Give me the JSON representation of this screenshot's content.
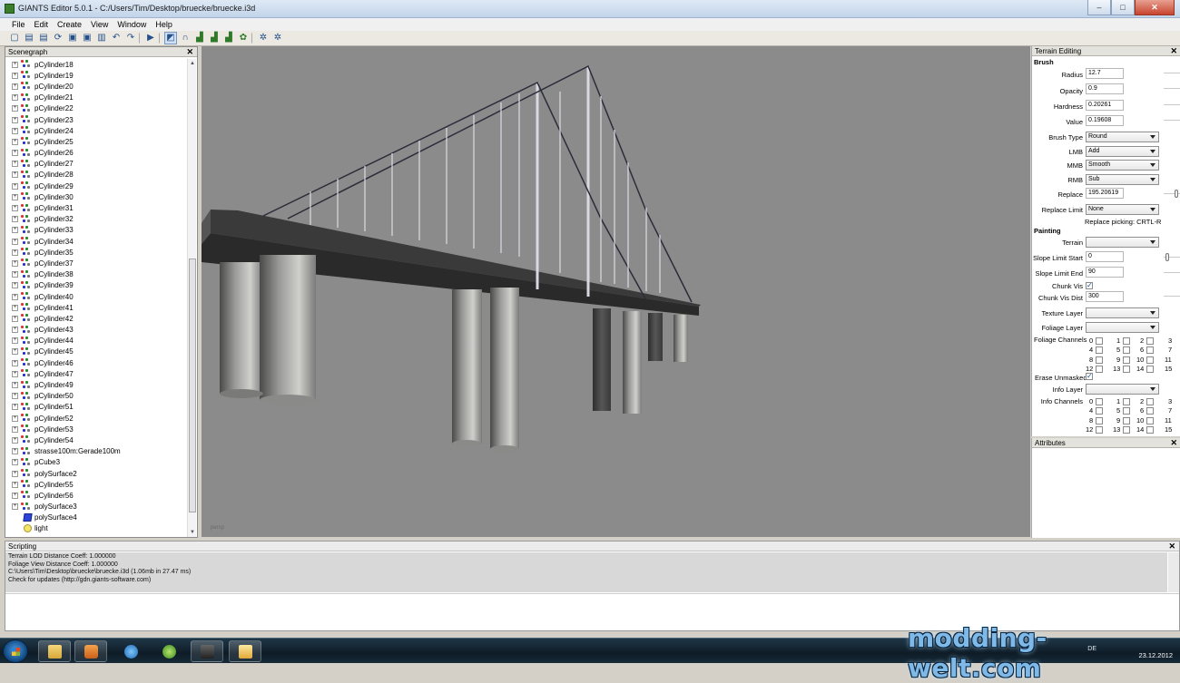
{
  "window": {
    "title": "GIANTS Editor 5.0.1 - C:/Users/Tim/Desktop/bruecke/bruecke.i3d",
    "controls": {
      "minimize": "–",
      "maximize": "□",
      "close": "✕"
    }
  },
  "menu": [
    "File",
    "Edit",
    "Create",
    "View",
    "Window",
    "Help"
  ],
  "toolbar": {
    "icons": [
      "new-file-icon",
      "open-folder-icon",
      "open-folder-icon",
      "refresh-icon",
      "save-icon",
      "save-as-icon",
      "clipboard-icon",
      "undo-icon",
      "redo-icon",
      "play-icon",
      "select-tool-icon",
      "magnet-tool-icon",
      "terrain-sculpt-icon",
      "terrain-paint-icon",
      "foliage-paint-icon",
      "grass-icon",
      "gear-icon",
      "gear-settings-icon"
    ],
    "glyphs": [
      "▢",
      "▤",
      "▤",
      "⟳",
      "▣",
      "▣",
      "▥",
      "↶",
      "↷",
      "▶",
      "◩",
      "∩",
      "▟",
      "▟",
      "▟",
      "✿",
      "✲",
      "✲"
    ]
  },
  "scenegraph": {
    "title": "Scenegraph",
    "close": "✕",
    "items": [
      {
        "label": "pCylinder18",
        "type": "mesh"
      },
      {
        "label": "pCylinder19",
        "type": "mesh"
      },
      {
        "label": "pCylinder20",
        "type": "mesh"
      },
      {
        "label": "pCylinder21",
        "type": "mesh"
      },
      {
        "label": "pCylinder22",
        "type": "mesh"
      },
      {
        "label": "pCylinder23",
        "type": "mesh"
      },
      {
        "label": "pCylinder24",
        "type": "mesh"
      },
      {
        "label": "pCylinder25",
        "type": "mesh"
      },
      {
        "label": "pCylinder26",
        "type": "mesh"
      },
      {
        "label": "pCylinder27",
        "type": "mesh"
      },
      {
        "label": "pCylinder28",
        "type": "mesh"
      },
      {
        "label": "pCylinder29",
        "type": "mesh"
      },
      {
        "label": "pCylinder30",
        "type": "mesh"
      },
      {
        "label": "pCylinder31",
        "type": "mesh"
      },
      {
        "label": "pCylinder32",
        "type": "mesh"
      },
      {
        "label": "pCylinder33",
        "type": "mesh"
      },
      {
        "label": "pCylinder34",
        "type": "mesh"
      },
      {
        "label": "pCylinder35",
        "type": "mesh"
      },
      {
        "label": "pCylinder37",
        "type": "mesh"
      },
      {
        "label": "pCylinder38",
        "type": "mesh"
      },
      {
        "label": "pCylinder39",
        "type": "mesh"
      },
      {
        "label": "pCylinder40",
        "type": "mesh"
      },
      {
        "label": "pCylinder41",
        "type": "mesh"
      },
      {
        "label": "pCylinder42",
        "type": "mesh"
      },
      {
        "label": "pCylinder43",
        "type": "mesh"
      },
      {
        "label": "pCylinder44",
        "type": "mesh"
      },
      {
        "label": "pCylinder45",
        "type": "mesh"
      },
      {
        "label": "pCylinder46",
        "type": "mesh"
      },
      {
        "label": "pCylinder47",
        "type": "mesh"
      },
      {
        "label": "pCylinder49",
        "type": "mesh"
      },
      {
        "label": "pCylinder50",
        "type": "mesh"
      },
      {
        "label": "pCylinder51",
        "type": "mesh"
      },
      {
        "label": "pCylinder52",
        "type": "mesh"
      },
      {
        "label": "pCylinder53",
        "type": "mesh"
      },
      {
        "label": "pCylinder54",
        "type": "mesh"
      },
      {
        "label": "strasse100m:Gerade100m",
        "type": "mesh"
      },
      {
        "label": "pCube3",
        "type": "mesh"
      },
      {
        "label": "polySurface2",
        "type": "mesh"
      },
      {
        "label": "pCylinder55",
        "type": "mesh"
      },
      {
        "label": "pCylinder56",
        "type": "mesh"
      },
      {
        "label": "polySurface3",
        "type": "mesh"
      },
      {
        "label": "polySurface4",
        "type": "cube"
      },
      {
        "label": "light",
        "type": "light"
      }
    ]
  },
  "viewport": {
    "camera_label": "persp",
    "bg": "#8b8b8b"
  },
  "terrain": {
    "title": "Terrain Editing",
    "close": "✕",
    "brush_header": "Brush",
    "radius_label": "Radius",
    "radius": "12.7",
    "opacity_label": "Opacity",
    "opacity": "0.9",
    "hardness_label": "Hardness",
    "hardness": "0.20261",
    "value_label": "Value",
    "value": "0.19608",
    "brush_type_label": "Brush Type",
    "brush_type": "Round",
    "lmb_label": "LMB",
    "lmb": "Add",
    "mmb_label": "MMB",
    "mmb": "Smooth",
    "rmb_label": "RMB",
    "rmb": "Sub",
    "replace_label": "Replace",
    "replace": "195.20619",
    "replace_limit_label": "Replace Limit",
    "replace_limit": "None",
    "replace_picking": "Replace picking: CRTL-R",
    "painting_header": "Painting",
    "terrain_label": "Terrain",
    "terrain_value": "",
    "slope_start_label": "Slope Limit Start",
    "slope_start": "0",
    "slope_end_label": "Slope Limit End",
    "slope_end": "90",
    "chunk_vis_label": "Chunk Vis",
    "chunk_vis_dist_label": "Chunk Vis Dist",
    "chunk_vis_dist": "300",
    "texture_layer_label": "Texture Layer",
    "foliage_layer_label": "Foliage Layer",
    "foliage_channels_label": "Foliage Channels",
    "erase_unmasked_label": "Erase Unmasked",
    "info_layer_label": "Info Layer",
    "info_channels_label": "Info Channels",
    "channel_rows": [
      [
        "0",
        "1",
        "2",
        "3"
      ],
      [
        "4",
        "5",
        "6",
        "7"
      ],
      [
        "8",
        "9",
        "10",
        "11"
      ],
      [
        "12",
        "13",
        "14",
        "15"
      ]
    ]
  },
  "attributes": {
    "title": "Attributes",
    "close": "✕"
  },
  "scripting": {
    "title": "Scripting",
    "close": "✕",
    "lines": [
      " Terrain LOD Distance Coeff:  1.000000",
      " Foliage View Distance Coeff:  1.000000",
      "C:\\Users\\Tim\\Desktop\\bruecke\\bruecke.i3d (1.06mb in 27.47 ms)",
      "Check for updates (http://gdn.giants-software.com)"
    ]
  },
  "taskbar": {
    "apps": [
      "explorer-icon",
      "media-player-icon",
      "internet-explorer-icon",
      "ccleaner-icon",
      "giants-editor-icon",
      "folder-icon"
    ]
  },
  "tray": {
    "lang": "DE",
    "date": "23.12.2012"
  },
  "watermark": "modding-welt.com",
  "colors": {
    "accent": "#2b45d8",
    "sky": "#8b8b8b",
    "watermark": "#7fb9e8"
  }
}
